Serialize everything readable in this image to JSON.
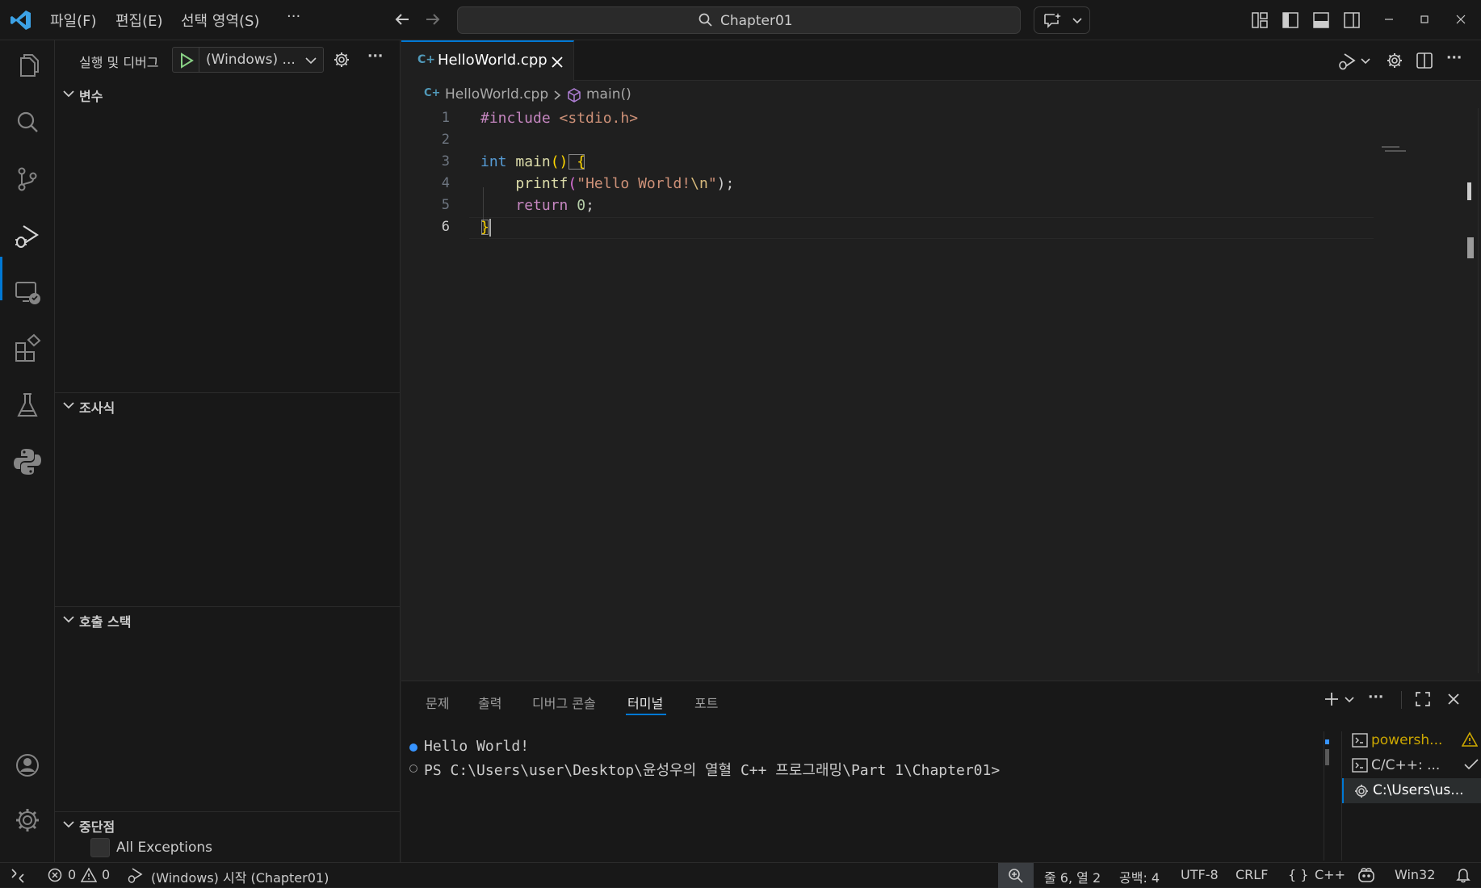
{
  "titlebar": {
    "menus": [
      "파일(F)",
      "편집(E)",
      "선택 영역(S)"
    ],
    "more": "···",
    "search_text": "Chapter01"
  },
  "sidebar": {
    "title": "실행 및 디버그",
    "config_name": "(Windows) ...",
    "more": "···",
    "sections": {
      "variables": "변수",
      "watch": "조사식",
      "callstack": "호출 스택",
      "breakpoints": "중단점"
    },
    "breakpoints": [
      {
        "label": "All Exceptions",
        "checked": false
      }
    ]
  },
  "editor": {
    "tab_label": "HelloWorld.cpp",
    "breadcrumb": {
      "file": "HelloWorld.cpp",
      "symbol": "main()"
    },
    "more": "···",
    "line_numbers": [
      "1",
      "2",
      "3",
      "4",
      "5",
      "6"
    ],
    "current_line": 6,
    "code": {
      "l1_include": "#include",
      "l1_header": " <stdio.h>",
      "l3_kw": "int",
      "l3_fn": " main",
      "l3_paren": "()",
      "l3_brace": " {",
      "l4_indent": "    ",
      "l4_fn": "printf",
      "l4_open": "(",
      "l4_str": "\"Hello World!",
      "l4_esc": "\\n",
      "l4_strend": "\"",
      "l4_close": ");",
      "l5_indent": "    ",
      "l5_kw": "return",
      "l5_num": " 0",
      "l5_semi": ";",
      "l6_brace": "}"
    }
  },
  "panel": {
    "tabs": [
      "문제",
      "출력",
      "디버그 콘솔",
      "터미널",
      "포트"
    ],
    "active_tab": "터미널",
    "more": "···",
    "terminal_lines": [
      "Hello World!",
      "PS C:\\Users\\user\\Desktop\\윤성우의 열혈 C++ 프로그래밍\\Part 1\\Chapter01>"
    ],
    "terminals": [
      {
        "label": "powersh...",
        "status": "warning"
      },
      {
        "label": "C/C++: ...",
        "status": "check"
      },
      {
        "label": "C:\\Users\\us...",
        "status": "active"
      }
    ]
  },
  "statusbar": {
    "errors": "0",
    "warnings": "0",
    "debug_target": "(Windows) 시작 (Chapter01)",
    "position": "줄 6, 열 2",
    "spaces": "공백: 4",
    "encoding": "UTF-8",
    "eol": "CRLF",
    "language": "C++",
    "platform": "Win32"
  },
  "colors": {
    "accent": "#0078d4",
    "background": "#1f1f1f",
    "sidebar": "#181818",
    "warning": "#cca700"
  }
}
